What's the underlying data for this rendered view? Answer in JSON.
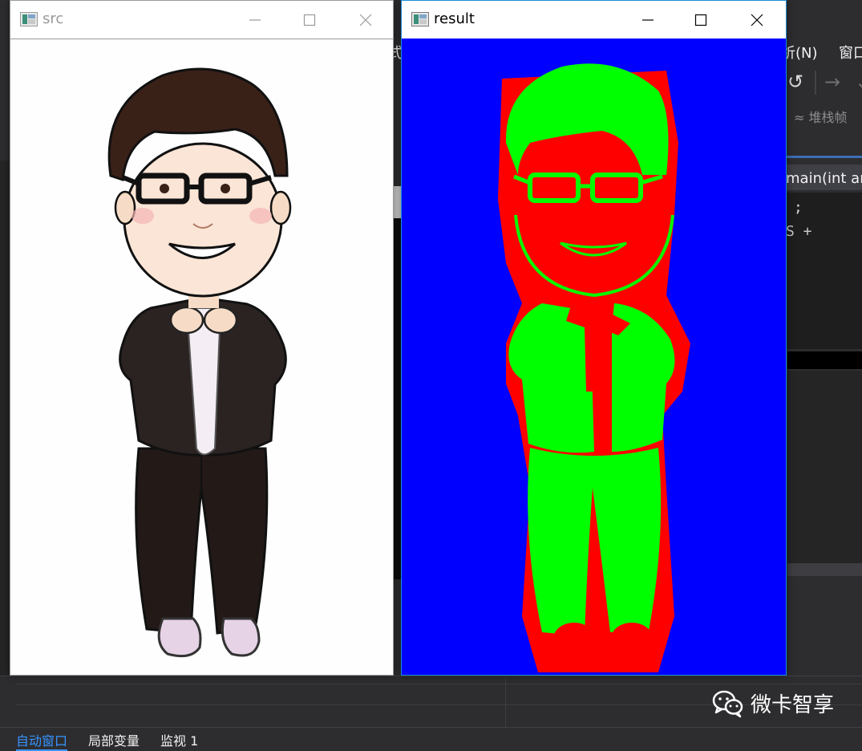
{
  "ide": {
    "menu": {
      "analyze": "析(N)",
      "window": "窗口",
      "partial": "式"
    },
    "toolbar": {
      "stack_frame": "堆栈帧",
      "redo_icon": "undo-arrow-icon",
      "forward_icon": "forward-arrow-icon"
    },
    "editor": {
      "function_sig": "main(int arg",
      "code_line_1": ";",
      "code_line_2": "S +"
    },
    "status_tabs": [
      "自动窗口",
      "局部变量",
      "监视 1"
    ]
  },
  "windows": {
    "src": {
      "title": "src"
    },
    "result": {
      "title": "result",
      "colors": {
        "background": "#0000ff",
        "foreground": "#00ff00",
        "probable": "#ff0000"
      }
    }
  },
  "watermark": {
    "text": "微卡智享",
    "icon": "wechat-icon"
  }
}
